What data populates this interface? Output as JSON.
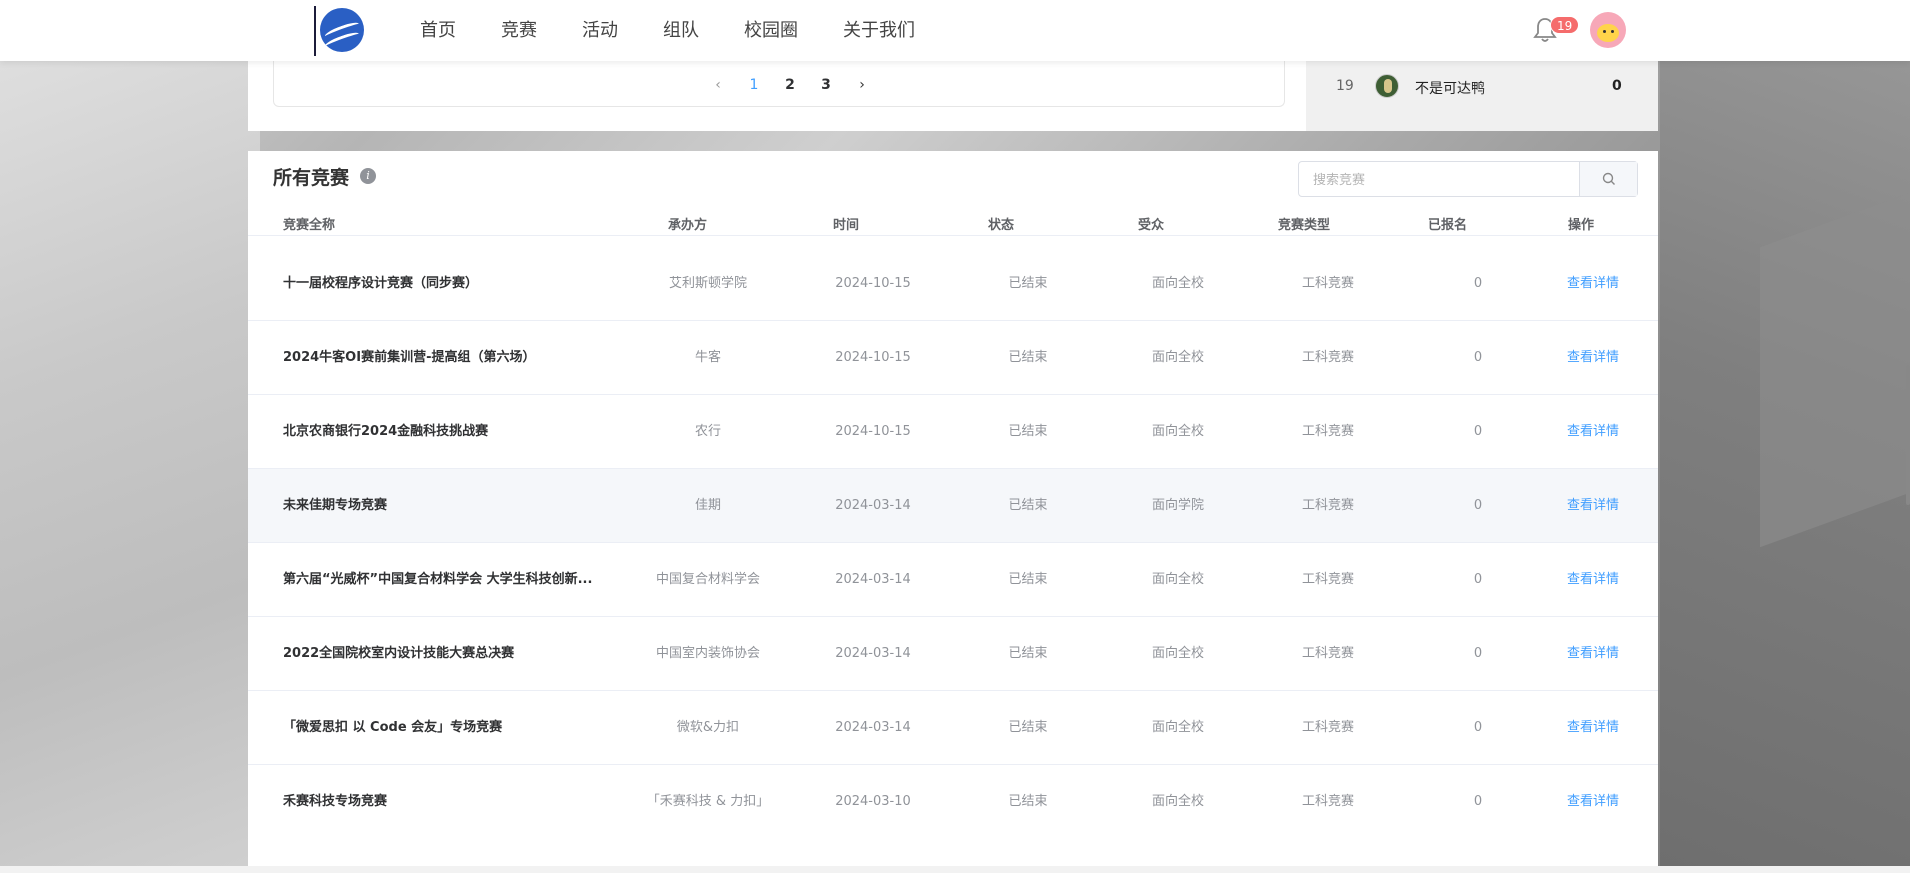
{
  "nav": {
    "items": [
      "首页",
      "竞赛",
      "活动",
      "组队",
      "校园圈",
      "关于我们"
    ],
    "notifications": "19"
  },
  "pagination": {
    "prev": "‹",
    "pages": [
      "1",
      "2",
      "3"
    ],
    "current": "1",
    "next": "›"
  },
  "ranking": {
    "rank": "19",
    "name": "不是可达鸭",
    "score": "0"
  },
  "competitions": {
    "title": "所有竞赛",
    "info_icon": "i",
    "search_placeholder": "搜索竞赛",
    "headers": [
      "竞赛全称",
      "承办方",
      "时间",
      "状态",
      "受众",
      "竞赛类型",
      "已报名",
      "操作"
    ],
    "rows": [
      {
        "name": "十一届校程序设计竞赛（同步赛）",
        "org": "艾利斯顿学院",
        "date": "2024-10-15",
        "status": "已结束",
        "audience": "面向全校",
        "type": "工科竞赛",
        "count": "0",
        "action": "查看详情"
      },
      {
        "name": "2024牛客OI赛前集训营-提高组（第六场）",
        "org": "牛客",
        "date": "2024-10-15",
        "status": "已结束",
        "audience": "面向全校",
        "type": "工科竞赛",
        "count": "0",
        "action": "查看详情"
      },
      {
        "name": "北京农商银行2024金融科技挑战赛",
        "org": "农行",
        "date": "2024-10-15",
        "status": "已结束",
        "audience": "面向全校",
        "type": "工科竞赛",
        "count": "0",
        "action": "查看详情"
      },
      {
        "name": "未来佳期专场竞赛",
        "org": "佳期",
        "date": "2024-03-14",
        "status": "已结束",
        "audience": "面向学院",
        "type": "工科竞赛",
        "count": "0",
        "action": "查看详情"
      },
      {
        "name": "第六届“光威杯”中国复合材料学会 大学生科技创新...",
        "org": "中国复合材料学会",
        "date": "2024-03-14",
        "status": "已结束",
        "audience": "面向全校",
        "type": "工科竞赛",
        "count": "0",
        "action": "查看详情"
      },
      {
        "name": "2022全国院校室内设计技能大赛总决赛",
        "org": "中国室内装饰协会",
        "date": "2024-03-14",
        "status": "已结束",
        "audience": "面向全校",
        "type": "工科竞赛",
        "count": "0",
        "action": "查看详情"
      },
      {
        "name": "「微爱思扣 以 Code 会友」专场竞赛",
        "org": "微软&力扣",
        "date": "2024-03-14",
        "status": "已结束",
        "audience": "面向全校",
        "type": "工科竞赛",
        "count": "0",
        "action": "查看详情"
      },
      {
        "name": "禾赛科技专场竞赛",
        "org": "「禾赛科技 & 力扣」",
        "date": "2024-03-10",
        "status": "已结束",
        "audience": "面向全校",
        "type": "工科竞赛",
        "count": "0",
        "action": "查看详情"
      }
    ]
  },
  "icons": [
    "logo-icon",
    "bell-icon",
    "avatar",
    "search-icon",
    "info-icon",
    "chevron-left-icon",
    "chevron-right-icon"
  ]
}
